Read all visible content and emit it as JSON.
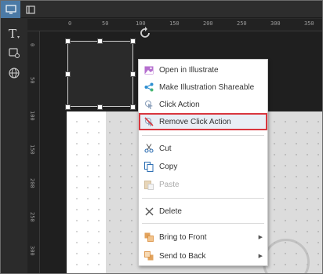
{
  "toolbar": {
    "items": [
      {
        "name": "monitor-view",
        "icon": "monitor-icon",
        "active": true
      },
      {
        "name": "panel-view",
        "icon": "panel-icon",
        "active": false
      }
    ]
  },
  "left_tools": {
    "text_tool": {
      "label": "T",
      "icon": "text-tool-icon"
    },
    "shape_tool": {
      "icon": "shape-tool-icon"
    },
    "web_tool": {
      "icon": "globe-icon"
    }
  },
  "rulers": {
    "top": [
      "0",
      "50",
      "100",
      "150",
      "200",
      "250",
      "300",
      "350"
    ],
    "left": [
      "0",
      "50",
      "100",
      "150",
      "200",
      "250",
      "300"
    ]
  },
  "context_menu": {
    "items": [
      {
        "id": "open",
        "label": "Open in Illustrate",
        "icon": "image-icon"
      },
      {
        "id": "share",
        "label": "Make Illustration Shareable",
        "icon": "share-icon"
      },
      {
        "id": "click",
        "label": "Click Action",
        "icon": "click-icon"
      },
      {
        "id": "remove",
        "label": "Remove Click Action",
        "icon": "remove-click-icon",
        "highlighted": true
      },
      {
        "id": "cut",
        "label": "Cut",
        "icon": "scissors-icon"
      },
      {
        "id": "copy",
        "label": "Copy",
        "icon": "copy-icon"
      },
      {
        "id": "paste",
        "label": "Paste",
        "icon": "paste-icon",
        "disabled": true
      },
      {
        "id": "delete",
        "label": "Delete",
        "icon": "delete-icon"
      },
      {
        "id": "front",
        "label": "Bring to Front",
        "icon": "bring-front-icon",
        "submenu": true
      },
      {
        "id": "back",
        "label": "Send to Back",
        "icon": "send-back-icon",
        "submenu": true
      }
    ]
  },
  "colors": {
    "accent": "#4b7aa6",
    "highlight_border": "#d9363e"
  }
}
